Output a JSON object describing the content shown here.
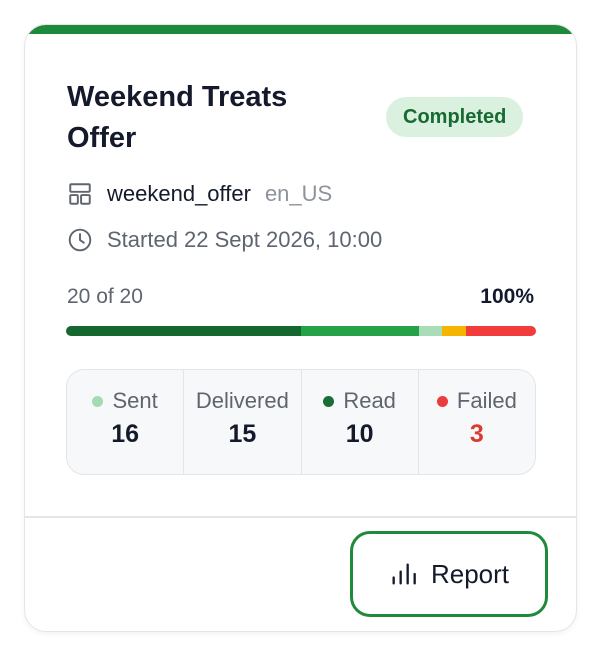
{
  "campaign": {
    "title": "Weekend Treats Offer",
    "status": "Completed",
    "template_name": "weekend_offer",
    "locale": "en_US",
    "started": "Started 22 Sept 2026, 10:00",
    "progress_text": "20 of 20",
    "progress_percent": "100%",
    "progress_value": 1.0
  },
  "breakdown": [
    {
      "key": "sent_deep",
      "share": 0.5,
      "color": "#16672f"
    },
    {
      "key": "delivered",
      "share": 0.25,
      "color": "#25a148"
    },
    {
      "key": "read",
      "share": 0.05,
      "color": "#aadcb7"
    },
    {
      "key": "pending",
      "share": 0.05,
      "color": "#f5b400"
    },
    {
      "key": "failed",
      "share": 0.15,
      "color": "#f23c3c"
    }
  ],
  "stats": [
    {
      "label": "Sent",
      "value": "16",
      "dot": "#a4dcb1"
    },
    {
      "label": "Delivered",
      "value": "15",
      "dot": ""
    },
    {
      "label": "Read",
      "value": "10",
      "dot": "#1a6d35"
    },
    {
      "label": "Failed",
      "value": "3",
      "dot": "#ec3c3c"
    }
  ],
  "actions": {
    "report_label": "Report"
  },
  "icons": {
    "template": "template-layout-icon",
    "clock": "clock-icon",
    "report": "bar-chart-icon"
  },
  "colors": {
    "accent": "#1f8a3b",
    "badge_bg": "#d9f1de",
    "badge_text": "#176a32",
    "failed_text": "#d93b33"
  }
}
